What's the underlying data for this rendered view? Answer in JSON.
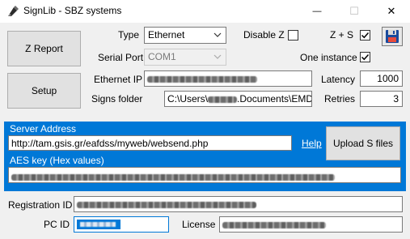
{
  "window": {
    "title": "SignLib - SBZ systems",
    "minimize_glyph": "—",
    "maximize_glyph": "☐",
    "close_glyph": "✕"
  },
  "buttons": {
    "z_report": "Z Report",
    "setup": "Setup",
    "upload": "Upload S files"
  },
  "settings": {
    "type_label": "Type",
    "type_value": "Ethernet",
    "serial_port_label": "Serial Port",
    "serial_port_value": "COM1",
    "ethernet_ip_label": "Ethernet IP",
    "signs_folder_label": "Signs folder",
    "signs_folder_prefix": "C:\\Users\\",
    "signs_folder_suffix": ".Documents\\EMDI\\fmu",
    "disable_z_label": "Disable Z",
    "disable_z_checked": false,
    "z_s_label": "Z + S",
    "z_s_checked": true,
    "one_instance_label": "One instance",
    "one_instance_checked": true,
    "latency_label": "Latency",
    "latency_value": "1000",
    "retries_label": "Retries",
    "retries_value": "3"
  },
  "server": {
    "address_label": "Server Address",
    "address_value": "http://tam.gsis.gr/eafdss/myweb/websend.php",
    "help_link": "Help",
    "aes_label": "AES key (Hex values)"
  },
  "registration": {
    "registration_id_label": "Registration ID",
    "pc_id_label": "PC ID",
    "license_label": "License"
  },
  "icons": {
    "app": "signlib-app-icon",
    "save": "floppy-disk-icon"
  },
  "colors": {
    "accent": "#0078d7",
    "title_bar": "#ffffff",
    "window_bg": "#f0f0f0"
  }
}
